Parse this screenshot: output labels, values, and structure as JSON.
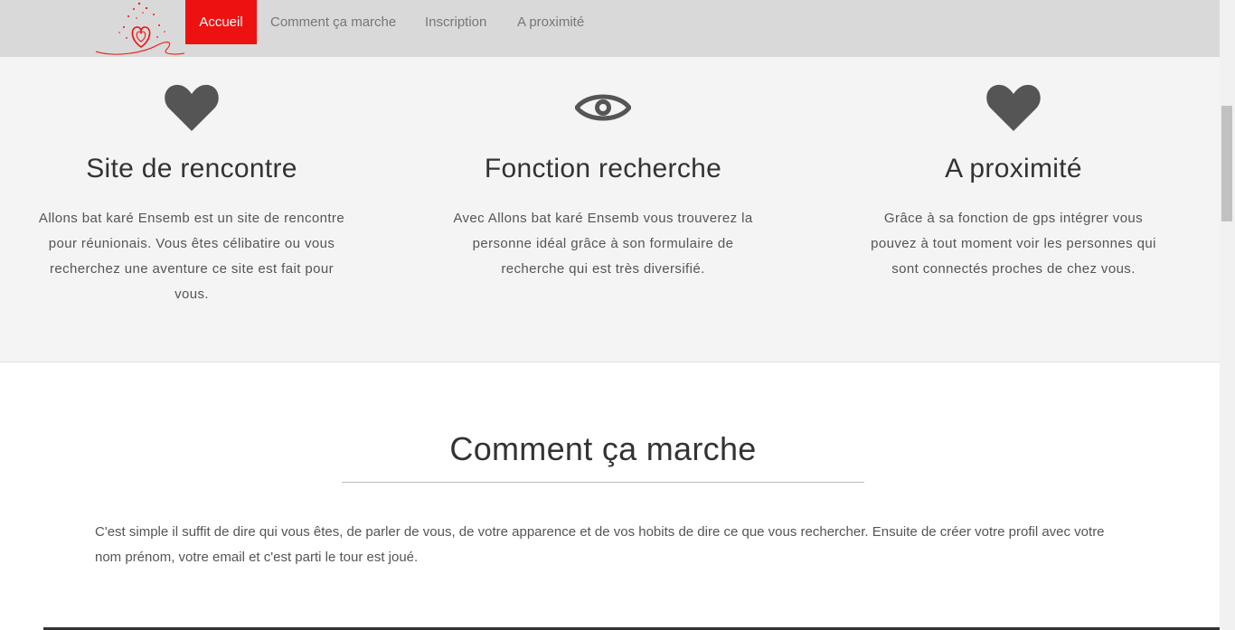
{
  "nav": {
    "items": [
      {
        "label": "Accueil",
        "active": true
      },
      {
        "label": "Comment ça marche",
        "active": false
      },
      {
        "label": "Inscription",
        "active": false
      },
      {
        "label": "A proximité",
        "active": false
      }
    ],
    "logo_icon": "heart-logo-icon",
    "active_color": "#ee1111",
    "bar_color": "#d9d9d9"
  },
  "features": [
    {
      "icon": "heart-icon",
      "title": "Site de rencontre",
      "text": "Allons bat karé Ensemb est un site de rencontre pour réunionais. Vous êtes célibatire ou vous recherchez une aventure ce site est fait pour vous."
    },
    {
      "icon": "eye-icon",
      "title": "Fonction recherche",
      "text": "Avec Allons bat karé Ensemb vous trouverez la personne idéal grâce à son formulaire de recherche qui est très diversifié."
    },
    {
      "icon": "heart-icon",
      "title": "A proximité",
      "text": "Grâce à sa fonction de gps intégrer vous pouvez à tout moment voir les personnes qui sont connectés proches de chez vous."
    }
  ],
  "how": {
    "title": "Comment ça marche",
    "text": "C'est simple il suffit de dire qui vous êtes, de parler de vous, de votre apparence et de vos hobits de dire ce que vous rechercher. Ensuite de créer votre profil avec votre nom prénom, votre email et c'est parti le tour est joué."
  }
}
